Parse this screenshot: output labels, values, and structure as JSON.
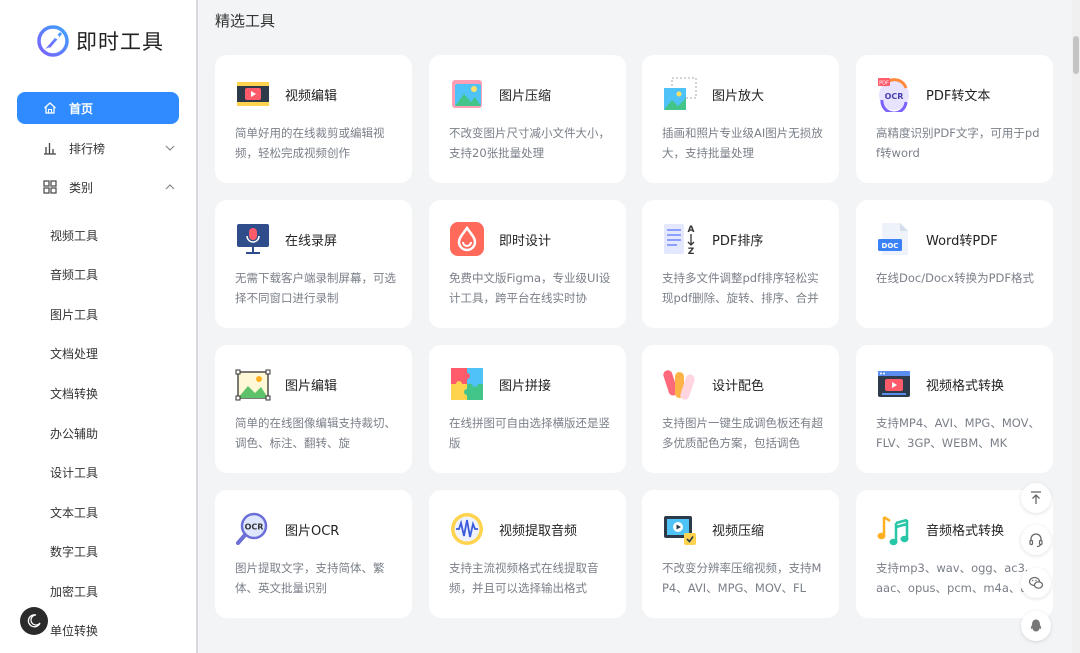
{
  "brand": {
    "name": "即时工具"
  },
  "sidebar": {
    "home": "首页",
    "ranking": "排行榜",
    "category": "类别",
    "sub_items": [
      "视频工具",
      "音频工具",
      "图片工具",
      "文档处理",
      "文档转换",
      "办公辅助",
      "设计工具",
      "文本工具",
      "数字工具",
      "加密工具",
      "单位转换"
    ]
  },
  "main": {
    "section_title": "精选工具",
    "cards": [
      {
        "title": "视频编辑",
        "desc": "简单好用的在线裁剪或编辑视频，轻松完成视频创作",
        "icon": "video-edit-icon"
      },
      {
        "title": "图片压缩",
        "desc": "不改变图片尺寸减小文件大小，支持20张批量处理",
        "icon": "image-compress-icon"
      },
      {
        "title": "图片放大",
        "desc": "插画和照片专业级AI图片无损放大，支持批量处理",
        "icon": "image-enlarge-icon"
      },
      {
        "title": "PDF转文本",
        "desc": "高精度识别PDF文字，可用于pdf转word",
        "icon": "pdf-ocr-icon"
      },
      {
        "title": "在线录屏",
        "desc": "无需下载客户端录制屏幕，可选择不同窗口进行录制",
        "icon": "screen-record-icon"
      },
      {
        "title": "即时设计",
        "desc": "免费中文版Figma，专业级UI设计工具，跨平台在线实时协",
        "icon": "jishi-design-icon"
      },
      {
        "title": "PDF排序",
        "desc": "支持多文件调整pdf排序轻松实现pdf删除、旋转、排序、合并",
        "icon": "pdf-sort-icon"
      },
      {
        "title": "Word转PDF",
        "desc": "在线Doc/Docx转换为PDF格式",
        "icon": "word-doc-icon"
      },
      {
        "title": "图片编辑",
        "desc": "简单的在线图像编辑支持裁切、调色、标注、翻转、旋",
        "icon": "image-edit-icon"
      },
      {
        "title": "图片拼接",
        "desc": "在线拼图可自由选择横版还是竖版",
        "icon": "puzzle-icon"
      },
      {
        "title": "设计配色",
        "desc": "支持图片一键生成调色板还有超多优质配色方案，包括调色",
        "icon": "color-palette-icon"
      },
      {
        "title": "视频格式转换",
        "desc": "支持MP4、AVI、MPG、MOV、FLV、3GP、WEBM、MK",
        "icon": "video-convert-icon"
      },
      {
        "title": "图片OCR",
        "desc": "图片提取文字，支持简体、繁体、英文批量识别",
        "icon": "image-ocr-icon"
      },
      {
        "title": "视频提取音频",
        "desc": "支持主流视频格式在线提取音频，并且可以选择输出格式",
        "icon": "audio-extract-icon"
      },
      {
        "title": "视频压缩",
        "desc": "不改变分辨率压缩视频，支持MP4、AVI、MPG、MOV、FL",
        "icon": "video-compress-icon"
      },
      {
        "title": "音频格式转换",
        "desc": "支持mp3、wav、ogg、ac3、aac、opus、pcm、m4a、aac",
        "icon": "music-notes-icon"
      }
    ]
  },
  "colors": {
    "accent": "#2f8bff",
    "background": "#f3f4f6",
    "card": "#ffffff",
    "desc": "#7a7f88"
  }
}
